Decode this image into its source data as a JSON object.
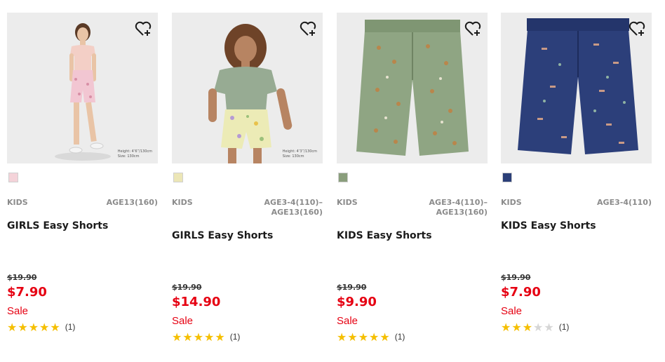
{
  "products": [
    {
      "category": "KIDS",
      "age": "AGE13(160)",
      "name": "GIRLS Easy Shorts",
      "original_price": "$19.90",
      "price": "$7.90",
      "sale_label": "Sale",
      "rating": 5,
      "review_count": "(1)",
      "model_info": "Height: 4’6”/130cm\nSize: 130cm",
      "swatch_color": "#f4d3d9",
      "favorite_icon": "heart-plus-icon"
    },
    {
      "category": "KIDS",
      "age": "AGE3-4(110)–\nAGE13(160)",
      "name": "GIRLS Easy Shorts",
      "original_price": "$19.90",
      "price": "$14.90",
      "sale_label": "Sale",
      "rating": 5,
      "review_count": "(1)",
      "model_info": "Height: 4’3”/130cm\nSize: 130cm",
      "swatch_color": "#ece6b6",
      "favorite_icon": "heart-plus-icon"
    },
    {
      "category": "KIDS",
      "age": "AGE3-4(110)–\nAGE13(160)",
      "name": "KIDS Easy Shorts",
      "original_price": "$19.90",
      "price": "$9.90",
      "sale_label": "Sale",
      "rating": 5,
      "review_count": "(1)",
      "swatch_color": "#8a9e7c",
      "favorite_icon": "heart-plus-icon"
    },
    {
      "category": "KIDS",
      "age": "AGE3-4(110)",
      "name": "KIDS Easy Shorts",
      "original_price": "$19.90",
      "price": "$7.90",
      "sale_label": "Sale",
      "rating": 3,
      "review_count": "(1)",
      "swatch_color": "#2b3f78",
      "favorite_icon": "heart-plus-icon"
    }
  ],
  "colors": {
    "sale_red": "#e60012",
    "star_gold": "#f5bf00",
    "star_empty": "#d6d6d6"
  }
}
